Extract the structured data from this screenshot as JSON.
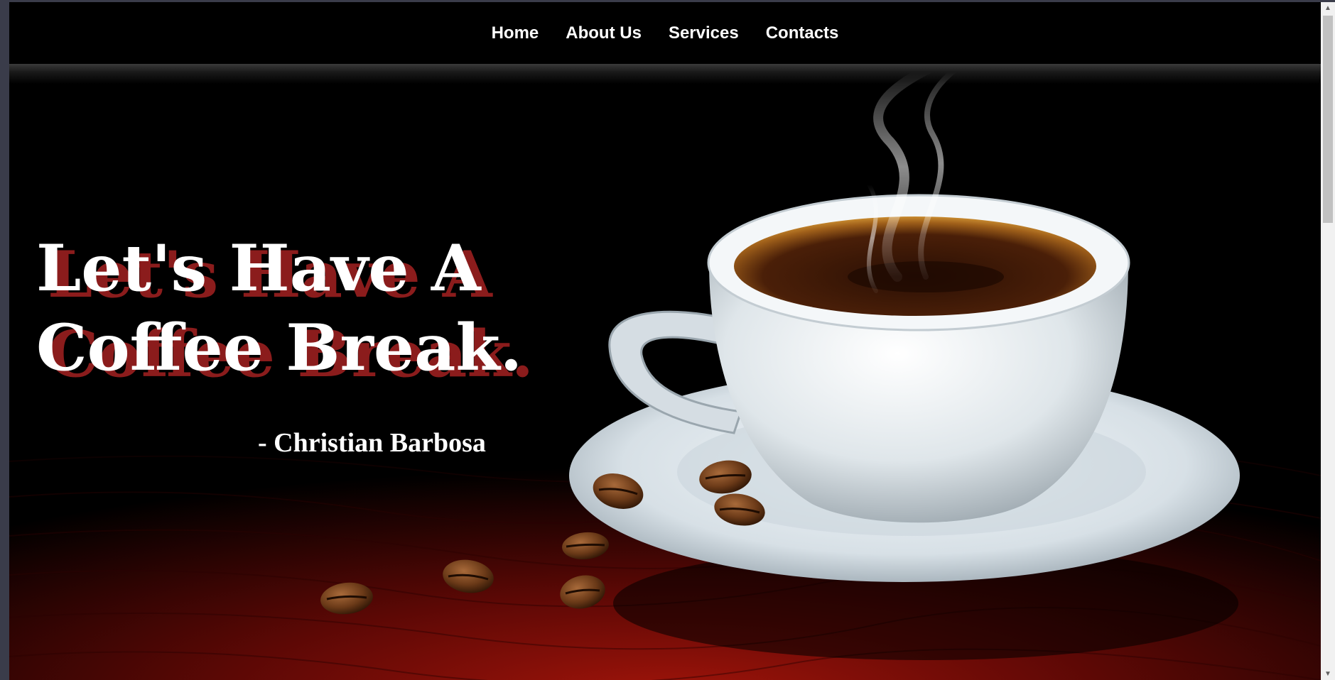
{
  "nav": {
    "items": [
      {
        "label": "Home"
      },
      {
        "label": "About Us"
      },
      {
        "label": "Services"
      },
      {
        "label": "Contacts"
      }
    ]
  },
  "hero": {
    "headline_line1": "Let's Have A",
    "headline_line2": "Coffee Break.",
    "author": "- Christian Barbosa",
    "image_subject": "coffee-cup-on-saucer-with-beans",
    "colors": {
      "headline_shadow": "#8b1c1c",
      "table_red": "#7a0a06",
      "background": "#000000"
    }
  },
  "scrollbar": {
    "up_icon": "triangle-up-icon",
    "down_icon": "triangle-down-icon"
  }
}
